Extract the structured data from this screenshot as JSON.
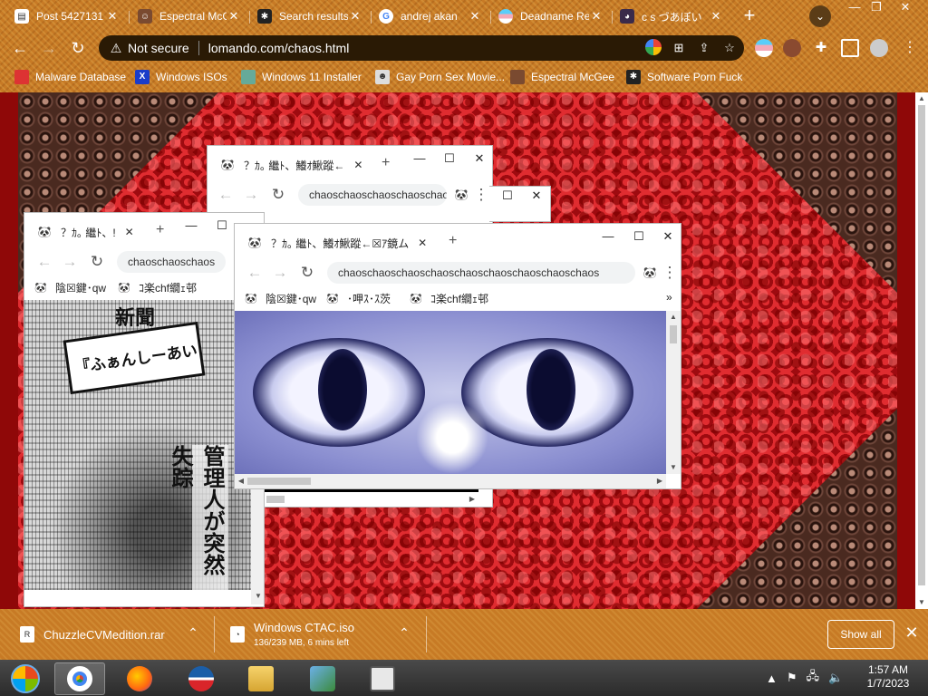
{
  "browser": {
    "tabs": [
      {
        "label": "Post 5427131",
        "favicon": "post-favicon"
      },
      {
        "label": "Espectral McG",
        "favicon": "avatar-favicon"
      },
      {
        "label": "Search results",
        "favicon": "spider-favicon"
      },
      {
        "label": "andrej akan",
        "favicon": "google-favicon"
      },
      {
        "label": "Deadname Re",
        "favicon": "flag-favicon"
      },
      {
        "label": "c s づあぼい",
        "favicon": "anime-favicon"
      }
    ],
    "new_tab": "+",
    "tab_search": "⌄",
    "window_controls": {
      "minimize": "—",
      "restore": "❐",
      "close": "✕"
    },
    "omnibox": {
      "security": "Not secure",
      "url": "lomando.com/chaos.html"
    },
    "bookmarks": [
      {
        "label": "Malware Database",
        "icon": "malware-bookmark-icon"
      },
      {
        "label": "Windows ISOs",
        "icon": "x-bookmark-icon"
      },
      {
        "label": "Windows 11 Installer",
        "icon": "image-bookmark-icon"
      },
      {
        "label": "Gay Porn Sex Movie...",
        "icon": "lego-bookmark-icon"
      },
      {
        "label": "Espectral McGee",
        "icon": "avatar-bookmark-icon"
      },
      {
        "label": "Software Porn Fuck",
        "icon": "spider-bookmark-icon"
      }
    ]
  },
  "popups": {
    "tab_title_short": "？ｶ｡ 繼ﾄ、!",
    "tab_title_mid": "？ｶ｡ 繼ﾄ、鱶ｵ鰍蹤←",
    "tab_title_long": "？ｶ｡ 繼ﾄ、鱶ｵ鰍蹤←☒ｱ鏡ム",
    "url_short": "chaoschaoschaos",
    "url_mid": "chaoschaoschaoschaoschao",
    "url_long": "chaoschaoschaoschaoschaoschaoschaoschaoschaos",
    "bm1": "陰☒鍵･qw",
    "bm1_partial": "腱･qw",
    "bm2": "･呷ｽ･ｽ茨",
    "bm3": "ｺ楽chf繝ｪ邨",
    "more": "»",
    "newspaper": {
      "masthead": "新聞",
      "headline": "『ふぁんしーあいらんど』",
      "column": "管理人が突然失踪"
    }
  },
  "downloads": {
    "items": [
      {
        "name": "ChuzzleCVMedition.rar",
        "status": ""
      },
      {
        "name": "Windows CTAC.iso",
        "status": "136/239 MB, 6 mins left"
      }
    ],
    "show_all": "Show all",
    "close": "✕"
  },
  "taskbar": {
    "apps": [
      "start-button",
      "chrome",
      "firefox",
      "obama",
      "explorer",
      "network",
      "store"
    ],
    "clock_time": "1:57 AM",
    "clock_date": "1/7/2023"
  },
  "colors": {
    "chrome_frame": "#c77a25",
    "page_red": "#c41a1e",
    "omnibox_bg": "#2a1a05"
  }
}
